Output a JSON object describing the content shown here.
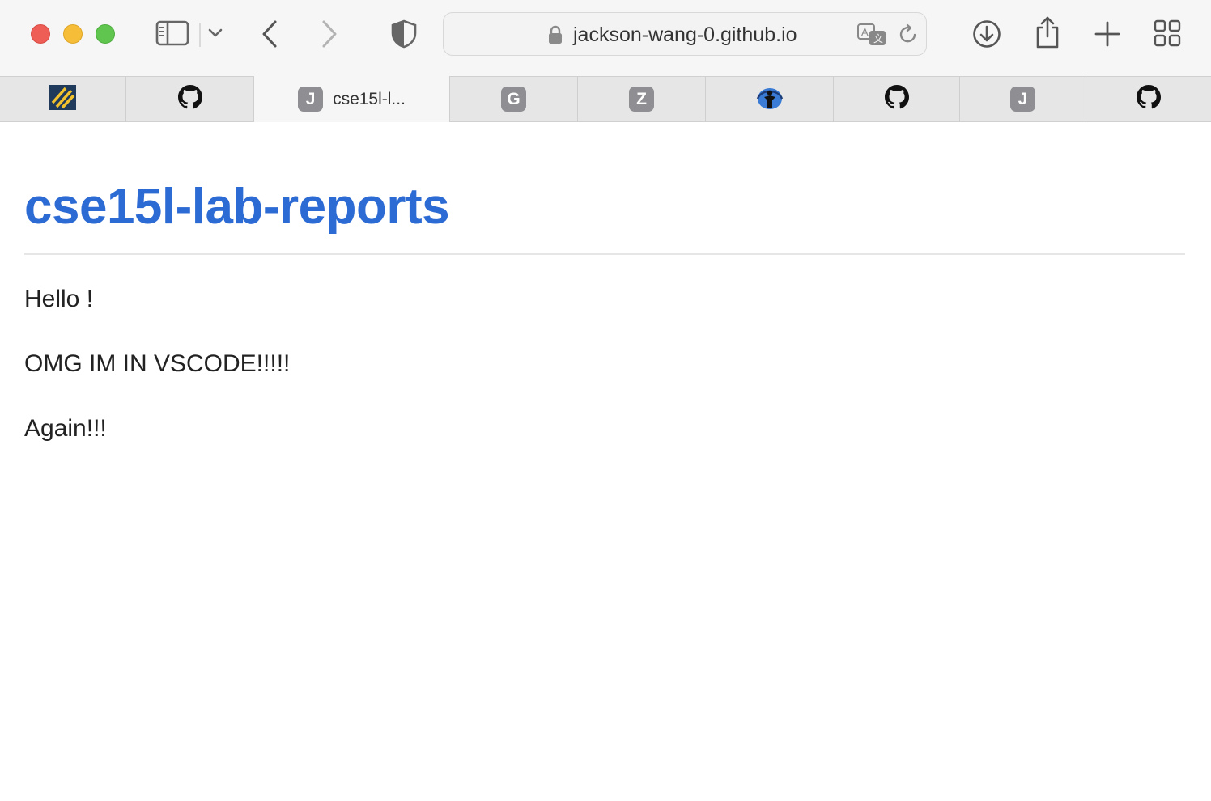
{
  "browser": {
    "url": "jackson-wang-0.github.io"
  },
  "tabs": [
    {
      "icon": "stripes-logo-icon"
    },
    {
      "icon": "github-icon"
    },
    {
      "icon": "letter-favicon",
      "letter": "J",
      "label": "cse15l-l...",
      "active": true
    },
    {
      "icon": "letter-favicon",
      "letter": "G"
    },
    {
      "icon": "letter-favicon",
      "letter": "Z"
    },
    {
      "icon": "globe-person-icon"
    },
    {
      "icon": "github-icon"
    },
    {
      "icon": "letter-favicon",
      "letter": "J"
    },
    {
      "icon": "github-icon"
    }
  ],
  "page": {
    "title": "cse15l-lab-reports",
    "paragraphs": [
      "Hello !",
      "OMG IM IN VSCODE!!!!!",
      "Again!!!"
    ]
  },
  "colors": {
    "title": "#2d6bd4",
    "close": "#ee5e56",
    "minimize": "#f6be38",
    "maximize": "#5fc54e",
    "favicon_letter_bg": "#8e8e93"
  }
}
